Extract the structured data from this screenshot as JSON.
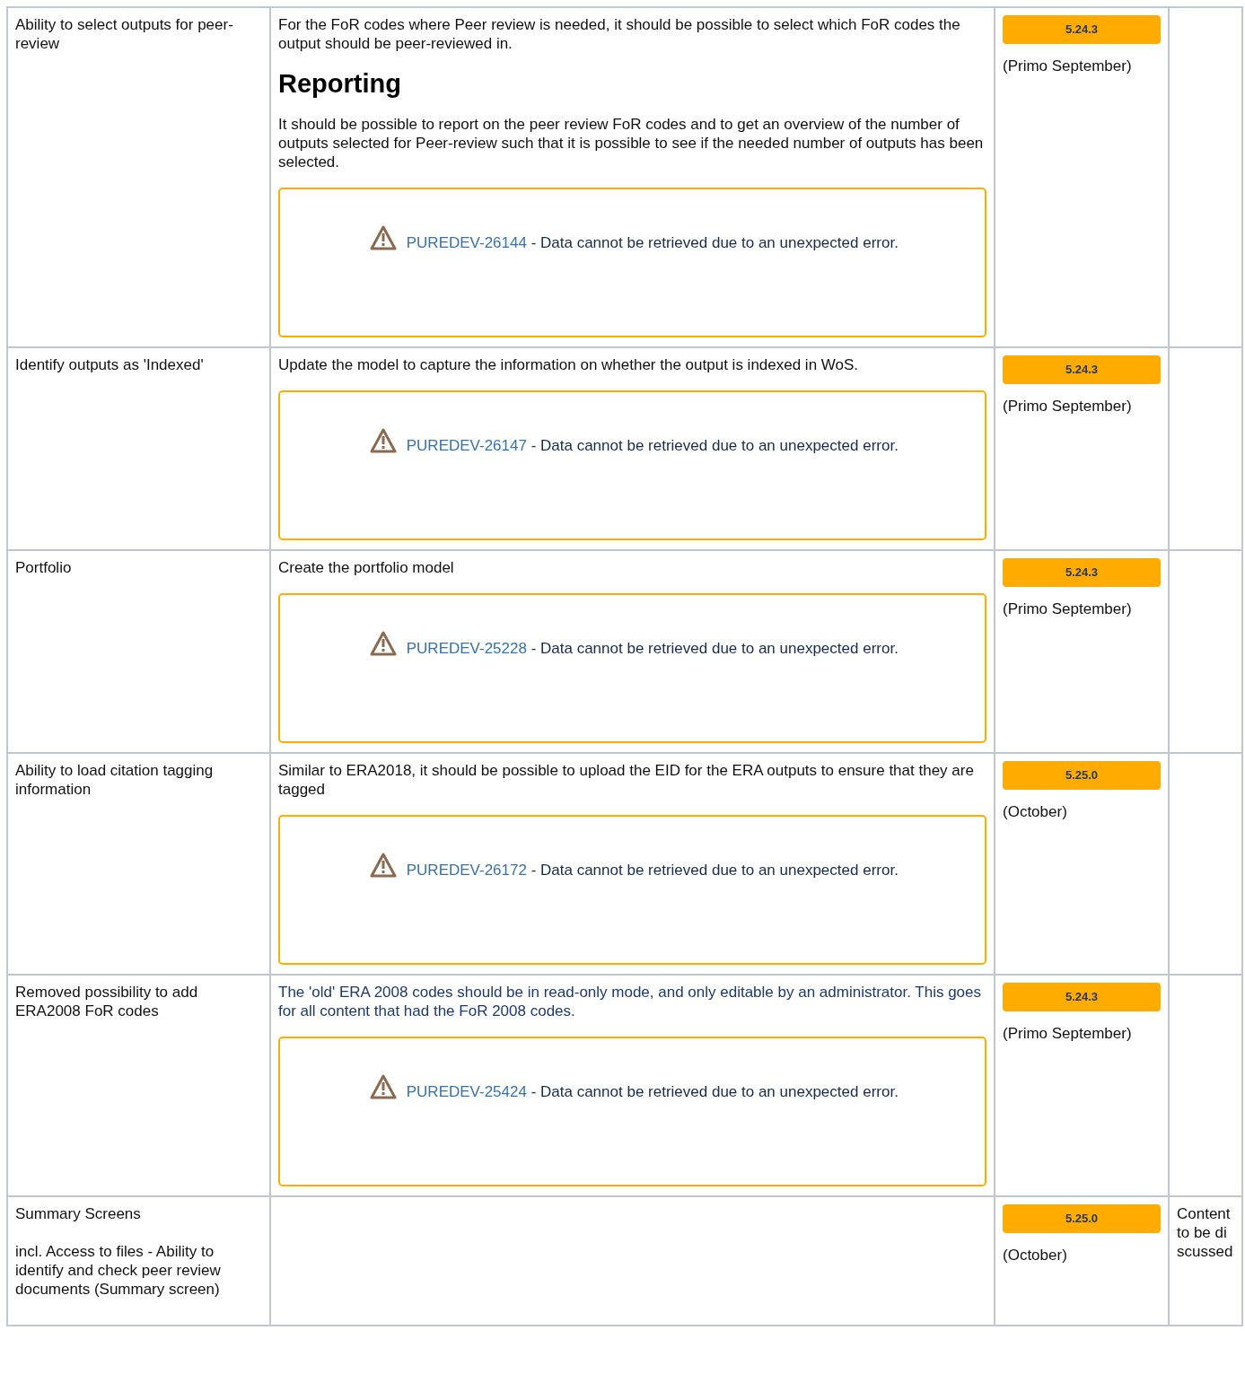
{
  "rows": [
    {
      "feature": [
        "Ability to select outputs for peer-review"
      ],
      "description": [
        {
          "kind": "paragraph",
          "text": "For the FoR codes where Peer review is needed, it should be possible to select which FoR codes the output should be peer-reviewed in."
        },
        {
          "kind": "heading",
          "text": "Reporting"
        },
        {
          "kind": "paragraph",
          "text": "It should be possible to report on the peer review FoR codes and to get an overview of the number of outputs selected for Peer-review such that it is possible to see if the needed number of outputs has been selected."
        }
      ],
      "error": {
        "issue": "PUREDEV-26144",
        "message": " - Data cannot be retrieved due to an unexpected error."
      },
      "release": {
        "version": "5.24.3",
        "note": "(Primo September)"
      }
    },
    {
      "feature": [
        "Identify outputs as 'Indexed'"
      ],
      "description": [
        {
          "kind": "paragraph",
          "text": "Update the model to capture the information on whether the output is indexed in WoS."
        }
      ],
      "error": {
        "issue": "PUREDEV-26147",
        "message": " - Data cannot be retrieved due to an unexpected error."
      },
      "release": {
        "version": "5.24.3",
        "note": "(Primo September)"
      }
    },
    {
      "feature": [
        "Portfolio"
      ],
      "description": [
        {
          "kind": "paragraph",
          "text": "Create the portfolio model"
        }
      ],
      "error": {
        "issue": "PUREDEV-25228",
        "message": " - Data cannot be retrieved due to an unexpected error."
      },
      "release": {
        "version": "5.24.3",
        "note": "(Primo September)"
      }
    },
    {
      "feature": [
        "Ability to load citation tagging information"
      ],
      "description": [
        {
          "kind": "paragraph",
          "text": "Similar to ERA2018, it should be possible to upload the EID for the ERA outputs to ensure that they are tagged"
        }
      ],
      "error": {
        "issue": "PUREDEV-26172",
        "message": " - Data cannot be retrieved due to an unexpected error."
      },
      "release": {
        "version": "5.25.0",
        "note": "(October)"
      }
    },
    {
      "feature": [
        "Removed possibility to add ERA2008 FoR codes"
      ],
      "description": [
        {
          "kind": "note",
          "text": "The 'old' ERA 2008 codes should be in read-only mode, and only editable by an administrator. This goes for all content that had the FoR 2008 codes."
        }
      ],
      "error": {
        "issue": "PUREDEV-25424",
        "message": " - Data cannot be retrieved due to an unexpected error."
      },
      "release": {
        "version": "5.24.3",
        "note": "(Primo September)"
      }
    },
    {
      "feature": [
        "Summary Screens",
        "incl. Access to files - Ability to identify and check peer review documents (Summary screen)"
      ],
      "description": [],
      "release": {
        "version": "5.25.0",
        "note": "(October)"
      },
      "notes": "Content to be discussed"
    }
  ]
}
